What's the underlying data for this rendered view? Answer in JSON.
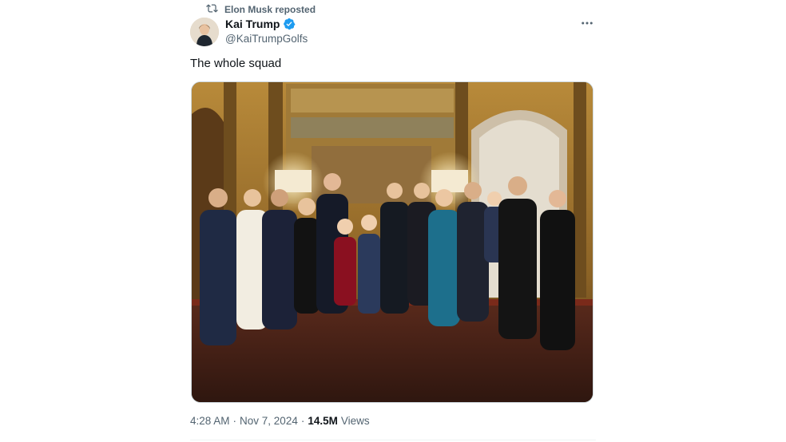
{
  "repost": {
    "icon": "repost-icon",
    "text": "Elon Musk reposted"
  },
  "author": {
    "name": "Kai Trump",
    "handle": "@KaiTrumpGolfs",
    "verified": true,
    "avatar": "profile-photo"
  },
  "tweet": {
    "text": "The whole squad"
  },
  "media": {
    "type": "photo"
  },
  "meta": {
    "time": "4:28 AM",
    "separator": "·",
    "date": "Nov 7, 2024",
    "views_count": "14.5M",
    "views_label": "Views"
  },
  "colors": {
    "primary_text": "#0f1419",
    "secondary_text": "#536471",
    "verified_blue": "#1d9bf0",
    "border": "#cfd9de"
  },
  "icons": {
    "more": "more-icon",
    "verified": "verified-badge-icon"
  }
}
